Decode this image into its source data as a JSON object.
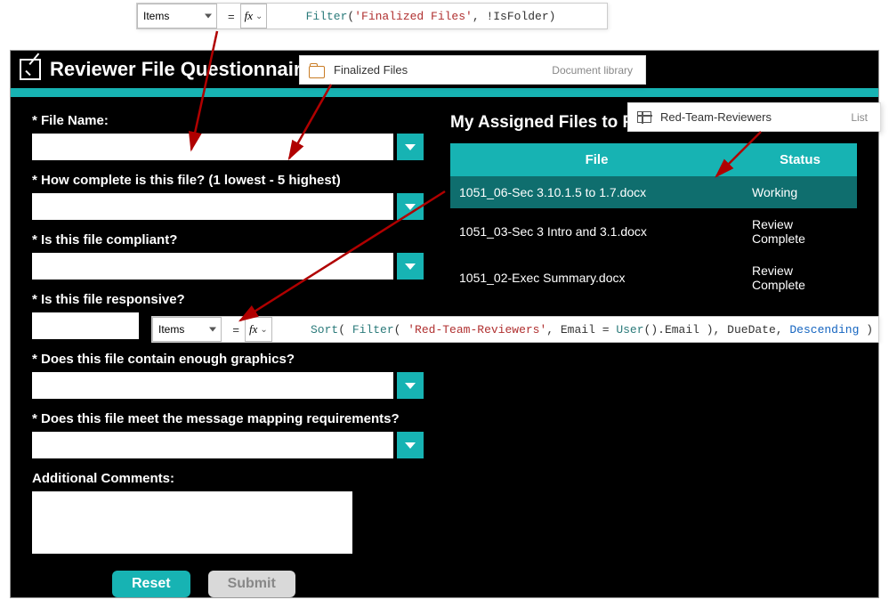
{
  "formula_top": {
    "property": "Items",
    "tokens": [
      "Filter",
      "(",
      "'Finalized Files'",
      ", !IsFolder",
      ")"
    ]
  },
  "formula_mid": {
    "property": "Items",
    "tokens": [
      "Sort",
      "( ",
      "Filter",
      "( ",
      "'Red-Team-Reviewers'",
      ", Email ",
      "=",
      " ",
      "User",
      "().Email ), DueDate, ",
      "Descending",
      " )"
    ]
  },
  "tooltip_doclib": {
    "name": "Finalized Files",
    "type": "Document library"
  },
  "tooltip_list": {
    "name": "Red-Team-Reviewers",
    "type": "List"
  },
  "app": {
    "title": "Reviewer File Questionnaire",
    "fields": {
      "f1": "* File Name:",
      "f2": "* How complete is this file? (1 lowest - 5 highest)",
      "f3": "* Is this file compliant?",
      "f4": "* Is this file responsive?",
      "f5": "* Does this file contain enough graphics?",
      "f6": "* Does this file meet the message mapping requirements?",
      "f7": "Additional Comments:"
    },
    "buttons": {
      "reset": "Reset",
      "submit": "Submit"
    },
    "panel_title": "My Assigned Files to Review",
    "grid": {
      "col_file": "File",
      "col_status": "Status",
      "rows": [
        {
          "file": "1051_06-Sec 3.10.1.5 to 1.7.docx",
          "status": "Working",
          "selected": true
        },
        {
          "file": "1051_03-Sec 3 Intro and 3.1.docx",
          "status": "Review Complete",
          "selected": false
        },
        {
          "file": "1051_02-Exec Summary.docx",
          "status": "Review Complete",
          "selected": false
        }
      ]
    }
  }
}
